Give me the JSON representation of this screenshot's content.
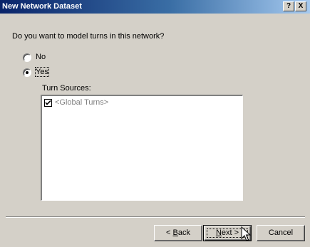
{
  "window": {
    "title": "New Network Dataset",
    "help_glyph": "?",
    "close_glyph": "X"
  },
  "question": "Do you want to model turns in this network?",
  "options": [
    {
      "label": "No",
      "selected": false
    },
    {
      "label": "Yes",
      "selected": true
    }
  ],
  "turn_sources": {
    "label": "Turn Sources:",
    "items": [
      {
        "label": "<Global Turns>",
        "checked": true
      }
    ]
  },
  "buttons": {
    "back": {
      "prefix": "< ",
      "mnemonic": "B",
      "rest": "ack"
    },
    "next": {
      "mnemonic": "N",
      "rest": "ext >"
    },
    "cancel": "Cancel"
  },
  "colors": {
    "dialog_bg": "#d4d0c8",
    "titlebar_start": "#0a246a",
    "titlebar_end": "#a6caf0",
    "disabled_text": "#808080"
  },
  "icons": {
    "help": "help-icon",
    "close": "close-icon",
    "check": "checkmark-icon",
    "cursor": "mouse-pointer-icon"
  }
}
